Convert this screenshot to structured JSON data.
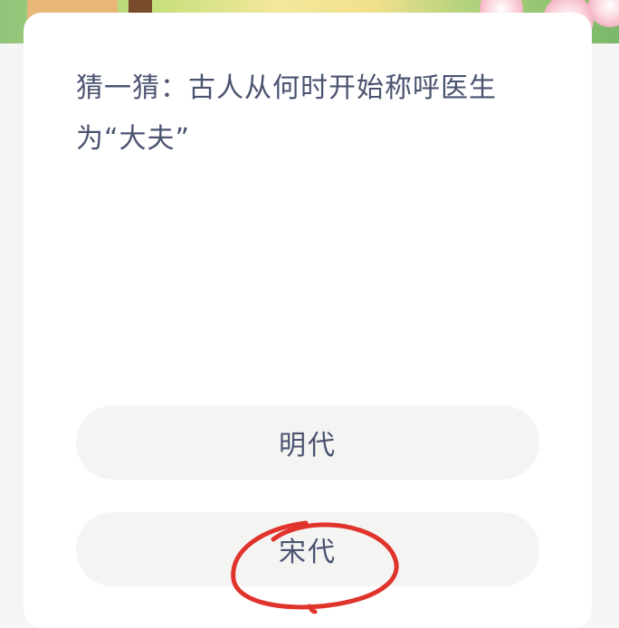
{
  "question": {
    "text_line1": "猜一猜：古人从何时开始称呼医生",
    "text_line2": "为“大夫”"
  },
  "options": [
    {
      "label": "明代"
    },
    {
      "label": "宋代"
    }
  ],
  "annotation": {
    "marked_option": "宋代",
    "color": "#e0332b"
  },
  "colors": {
    "text": "#4a5370",
    "option_bg": "#f4f4f3",
    "card_bg": "#ffffff",
    "page_bg": "#f5f5f3"
  }
}
